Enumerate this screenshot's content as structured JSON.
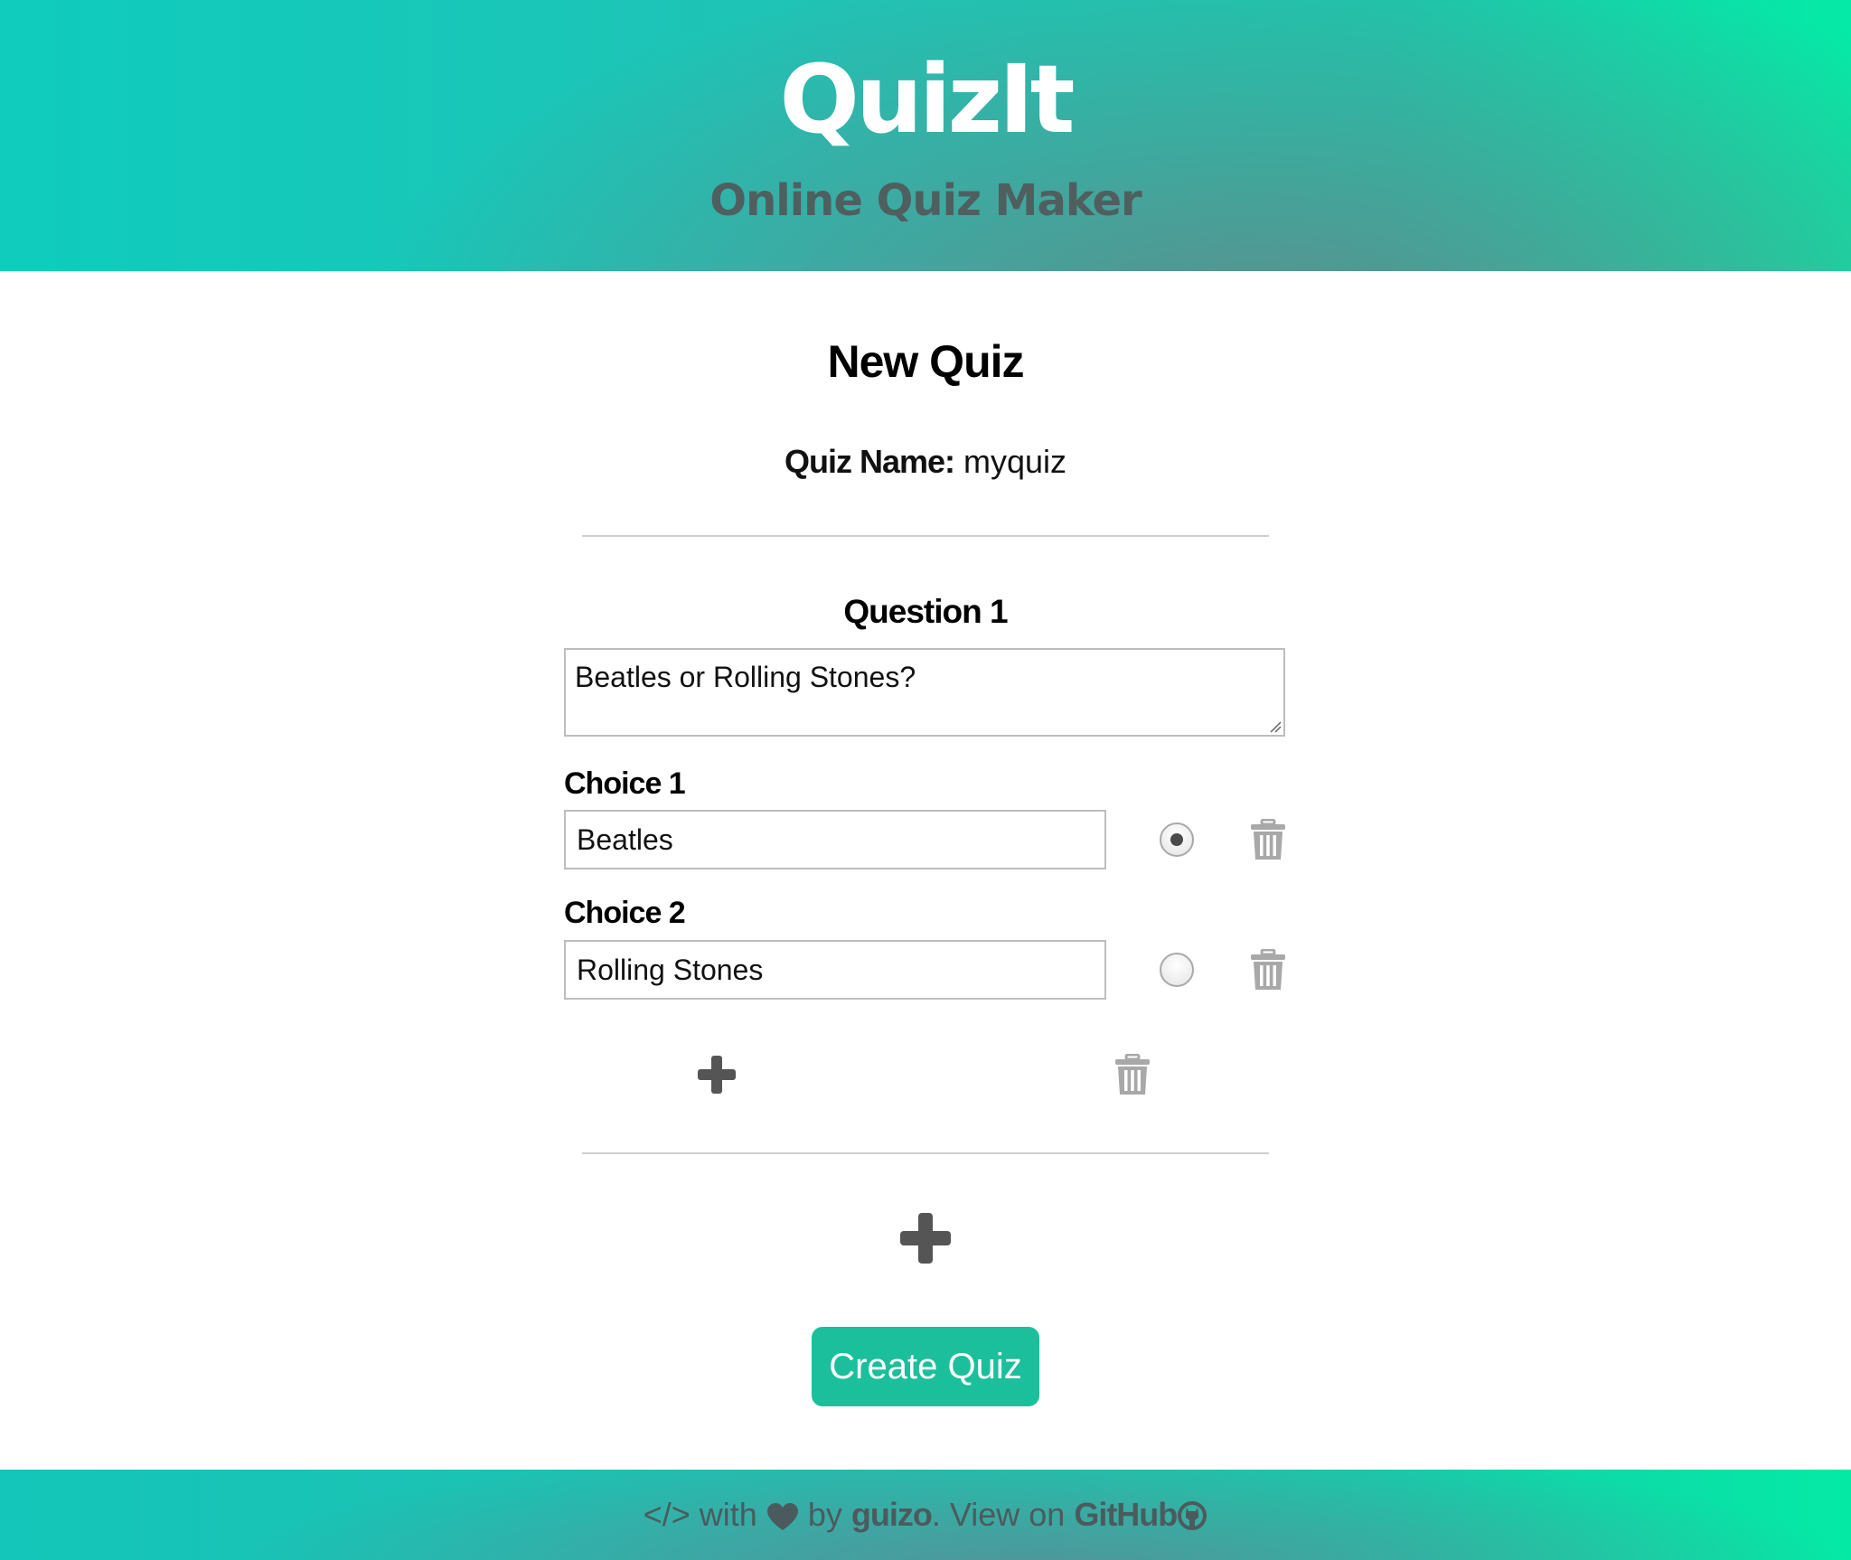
{
  "header": {
    "logo": "QuizIt",
    "tagline": "Online Quiz Maker"
  },
  "page_title": "New Quiz",
  "quiz": {
    "name_label": "Quiz Name:",
    "name_value": "myquiz"
  },
  "questions": [
    {
      "title": "Question 1",
      "text": "Beatles or Rolling Stones?",
      "choices": [
        {
          "label": "Choice 1",
          "value": "Beatles",
          "correct": true
        },
        {
          "label": "Choice 2",
          "value": "Rolling Stones",
          "correct": false
        }
      ]
    }
  ],
  "icons": {
    "add_choice": "plus-icon",
    "delete_question": "trash-icon",
    "delete_choice": "trash-icon",
    "add_question": "plus-icon",
    "code": "code-icon",
    "heart": "heart-icon",
    "github": "github-icon"
  },
  "create_button": "Create Quiz",
  "footer": {
    "code": "</>",
    "with": "with",
    "by": "by",
    "author": "guizo",
    "view_on": ". View on",
    "github": "GitHub"
  },
  "colors": {
    "accent": "#1bbf9b",
    "header_start": "#0fccbd",
    "header_end": "#05eaa6",
    "dark_text": "#4f5f5f",
    "icon_gray": "#a8a8a8",
    "icon_dark": "#555555"
  }
}
